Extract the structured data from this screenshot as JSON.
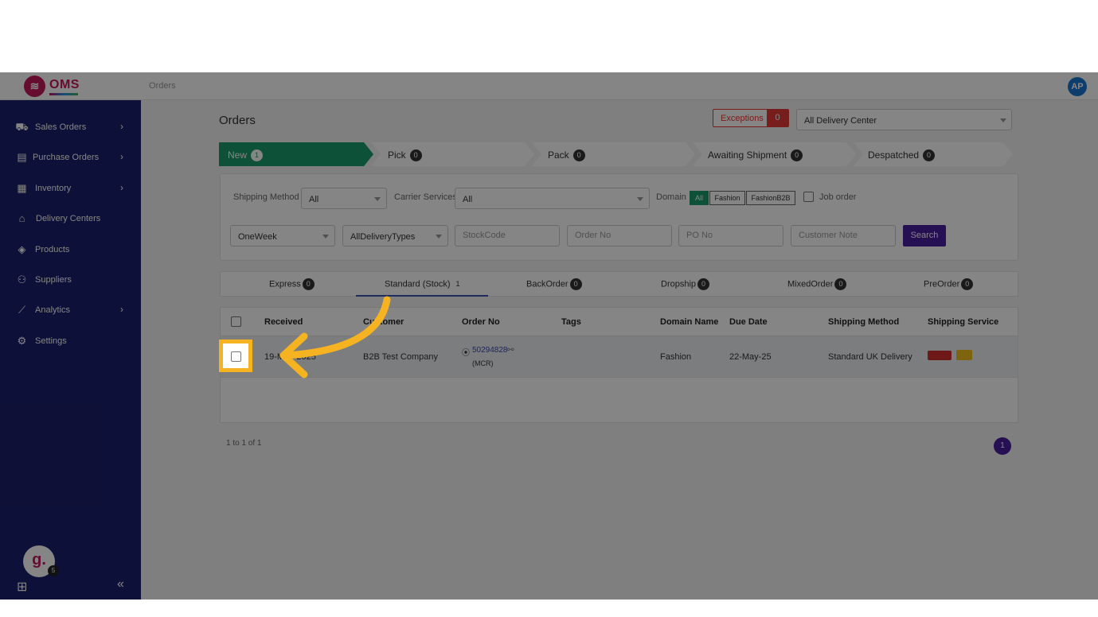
{
  "app": {
    "logo_text": "OMS",
    "breadcrumb": "Orders",
    "user_initials": "AP"
  },
  "sidebar": {
    "items": [
      {
        "label": "Sales Orders",
        "icon": "truck-icon",
        "has_children": true
      },
      {
        "label": "Purchase Orders",
        "icon": "document-icon",
        "has_children": true
      },
      {
        "label": "Inventory",
        "icon": "boxes-icon",
        "has_children": true
      },
      {
        "label": "Delivery Centers",
        "icon": "warehouse-icon",
        "has_children": false
      },
      {
        "label": "Products",
        "icon": "cube-icon",
        "has_children": false
      },
      {
        "label": "Suppliers",
        "icon": "users-icon",
        "has_children": false
      },
      {
        "label": "Analytics",
        "icon": "chart-icon",
        "has_children": true
      },
      {
        "label": "Settings",
        "icon": "gear-icon",
        "has_children": false
      }
    ],
    "assistant_initial": "g.",
    "assistant_badge": "5"
  },
  "page": {
    "title": "Orders",
    "exceptions_label": "Exceptions",
    "exceptions_count": "0",
    "delivery_center": "All Delivery Center"
  },
  "stages": [
    {
      "label": "New",
      "count": "1",
      "active": true
    },
    {
      "label": "Pick",
      "count": "0"
    },
    {
      "label": "Pack",
      "count": "0"
    },
    {
      "label": "Awaiting Shipment",
      "count": "0"
    },
    {
      "label": "Despatched",
      "count": "0"
    }
  ],
  "filters": {
    "shipping_method_label": "Shipping Method",
    "shipping_method_value": "All",
    "carrier_services_label": "Carrier Services",
    "carrier_services_value": "All",
    "domain_label": "Domain",
    "domain_options": [
      "All",
      "Fashion",
      "FashionB2B"
    ],
    "job_order_label": "Job order",
    "period_value": "OneWeek",
    "delivery_types_value": "AllDeliveryTypes",
    "stock_code_placeholder": "StockCode",
    "order_no_placeholder": "Order No",
    "po_no_placeholder": "PO No",
    "customer_note_placeholder": "Customer Note",
    "search_label": "Search"
  },
  "subtabs": [
    {
      "label": "Express",
      "count": "0"
    },
    {
      "label": "Standard (Stock)",
      "count": "1",
      "active": true
    },
    {
      "label": "BackOrder",
      "count": "0"
    },
    {
      "label": "Dropship",
      "count": "0"
    },
    {
      "label": "MixedOrder",
      "count": "0"
    },
    {
      "label": "PreOrder",
      "count": "0"
    }
  ],
  "table": {
    "columns": [
      "Received",
      "Customer",
      "Order No",
      "Tags",
      "Domain Name",
      "Due Date",
      "Shipping Method",
      "Shipping Service"
    ],
    "rows": [
      {
        "received": "19-May-2025",
        "customer": "B2B Test Company",
        "order_no": "50294828",
        "order_sub": "(MCR)",
        "tags": "",
        "domain": "Fashion",
        "due_date": "22-May-25",
        "shipping_method": "Standard UK Delivery"
      }
    ]
  },
  "pagination": {
    "info": "1 to 1 of 1",
    "current_page": "1"
  },
  "colors": {
    "sidebar": "#1a1f6b",
    "active_stage": "#1a9b6c",
    "primary_button": "#4a1e9e",
    "highlight": "#f5b322",
    "exceptions": "#e53935"
  }
}
